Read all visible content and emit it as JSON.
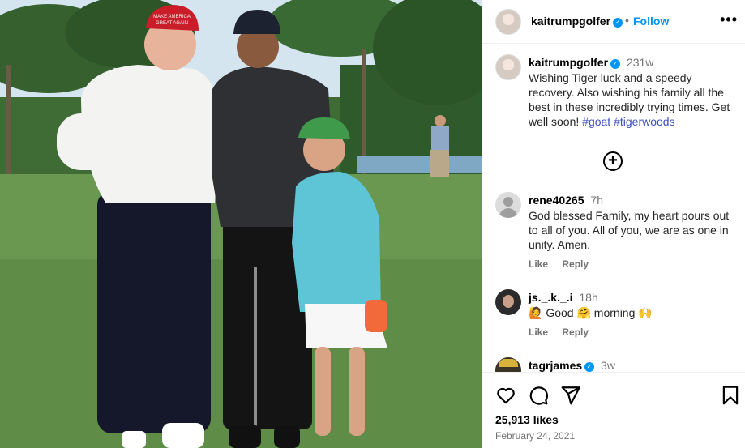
{
  "post": {
    "username": "kaitrumpgolfer",
    "follow_label": "Follow",
    "separator": "•",
    "more_icon": "more-horizontal-icon",
    "caption_time": "231w",
    "caption_text": "Wishing Tiger luck and a speedy recovery. Also wishing his family all the best in these incredibly trying times. Get well soon! ",
    "hashtags": [
      "#goat",
      "#tigerwoods"
    ],
    "hat_text_line1": "MAKE AMERICA",
    "hat_text_line2": "GREAT AGAIN"
  },
  "comments": [
    {
      "username": "rene40265",
      "time": "7h",
      "text": "God blessed Family, my heart pours out to all of you. All of you, we are as one in unity. Amen.",
      "like_label": "Like",
      "reply_label": "Reply"
    },
    {
      "username": "js._.k._.i",
      "time": "18h",
      "emoji1": "🙋",
      "word1": "Good",
      "emoji2": "🤗",
      "word2": "morning",
      "emoji3": "🙌",
      "like_label": "Like",
      "reply_label": "Reply"
    },
    {
      "username": "tagrjames",
      "time": "3w"
    }
  ],
  "footer": {
    "likes": "25,913 likes",
    "date": "February 24, 2021"
  },
  "colors": {
    "accent": "#0095f6",
    "hashtag": "#3f4fbf",
    "muted": "#737373"
  }
}
